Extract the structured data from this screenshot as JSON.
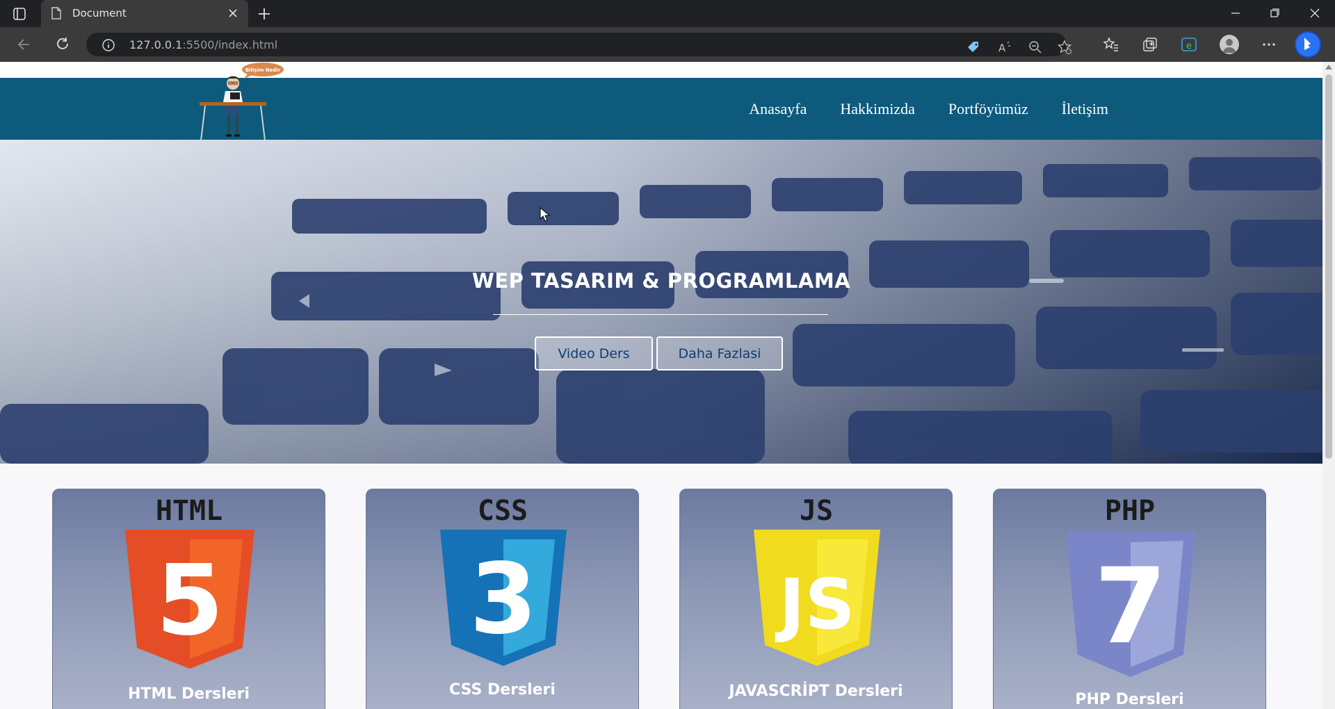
{
  "browser": {
    "tab_title": "Document",
    "url_host": "127.0.0.1",
    "url_path": ":5500/index.html"
  },
  "logo": {
    "bubble_text": "Bilişim Nedir"
  },
  "nav": {
    "items": [
      "Anasayfa",
      "Hakkimizda",
      "Portföyümüz",
      "İletişim"
    ]
  },
  "hero": {
    "title": "WEP TASARIM & PROGRAMLAMA",
    "buttons": [
      "Video Ders",
      "Daha Fazlasi"
    ]
  },
  "cards": [
    {
      "heading": "HTML",
      "badge": "5",
      "caption": "HTML Dersleri",
      "color": "#e44d26"
    },
    {
      "heading": "CSS",
      "badge": "3",
      "caption": "CSS Dersleri",
      "color": "#1572b6"
    },
    {
      "heading": "JS",
      "badge": "JS",
      "caption": "JAVASCRİPT Dersleri",
      "color": "#f7df1e"
    },
    {
      "heading": "PHP",
      "badge": "7",
      "caption": "PHP Dersleri",
      "color": "#7a86c8"
    }
  ],
  "icons": [
    "tab-actions-icon",
    "document-icon",
    "close-icon",
    "plus-icon",
    "minimize-icon",
    "restore-icon",
    "window-close-icon",
    "back-icon",
    "refresh-icon",
    "info-icon",
    "tag-icon",
    "read-aloud-icon",
    "zoom-out-icon",
    "favorite-add-icon",
    "favorites-icon",
    "collections-icon",
    "edge-icon",
    "profile-icon",
    "more-icon",
    "bing-icon"
  ]
}
